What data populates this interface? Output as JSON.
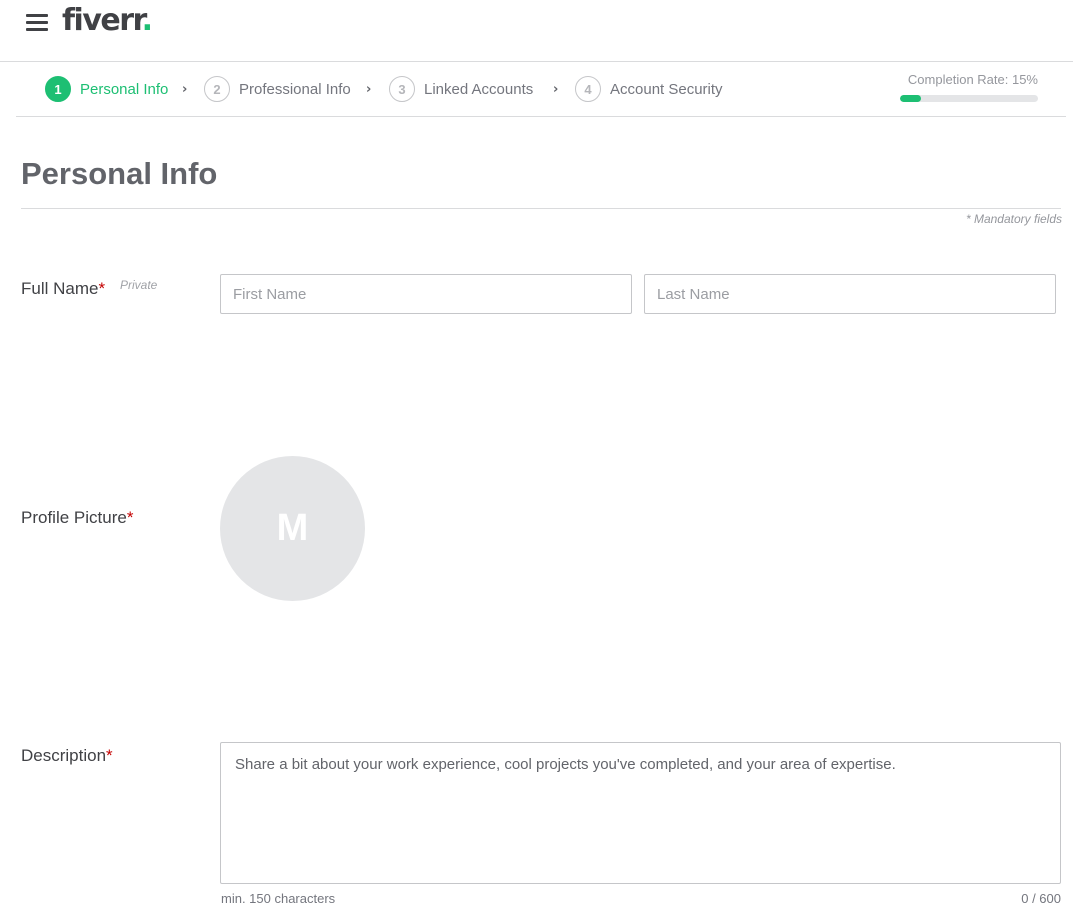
{
  "header": {
    "logo_text": "fiverr",
    "logo_dot": "."
  },
  "steps": [
    {
      "number": "1",
      "label": "Personal Info",
      "active": true
    },
    {
      "number": "2",
      "label": "Professional Info",
      "active": false
    },
    {
      "number": "3",
      "label": "Linked Accounts",
      "active": false
    },
    {
      "number": "4",
      "label": "Account Security",
      "active": false
    }
  ],
  "completion": {
    "label": "Completion Rate: 15%",
    "percent": 15
  },
  "page": {
    "title": "Personal Info",
    "mandatory_note": "* Mandatory fields"
  },
  "full_name": {
    "label": "Full Name",
    "required_mark": "*",
    "private_tag": "Private",
    "first_placeholder": "First Name",
    "last_placeholder": "Last Name"
  },
  "profile_picture": {
    "label": "Profile Picture",
    "required_mark": "*",
    "initial": "M"
  },
  "description": {
    "label": "Description",
    "required_mark": "*",
    "placeholder": "Share a bit about your work experience, cool projects you've completed, and your area of expertise.",
    "min_hint": "min. 150 characters",
    "counter": "0 / 600"
  },
  "colors": {
    "brand_green": "#1dbf73",
    "required_red": "#c40000"
  },
  "icons": {
    "menu": "hamburger-icon",
    "step_separator": "chevron-right-icon"
  }
}
